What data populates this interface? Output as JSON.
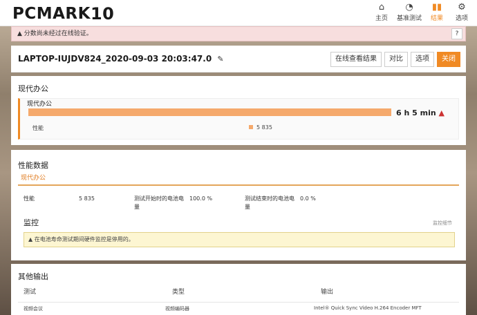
{
  "header": {
    "logo": "PCMARK",
    "logo_num": "10",
    "nav": [
      {
        "label": "主页",
        "icon": "home-icon"
      },
      {
        "label": "基准测试",
        "icon": "gauge-icon"
      },
      {
        "label": "结果",
        "icon": "bar-chart-icon"
      },
      {
        "label": "选项",
        "icon": "gear-icon"
      }
    ],
    "accent": "#f08a24"
  },
  "warning": {
    "text": "分数尚未经过在线验证。",
    "help": "?"
  },
  "result": {
    "title": "LAPTOP-IUJDV824_2020-09-03 20:03:47.0",
    "buttons": {
      "view_online": "在线查看结果",
      "compare": "对比",
      "options": "选项",
      "close": "关闭"
    }
  },
  "office": {
    "section": "现代办公",
    "inner_label": "现代办公",
    "time": "6 h 5 min",
    "perf_label": "性能",
    "perf_value": "5 835"
  },
  "perf": {
    "section": "性能数据",
    "tab": "现代办公",
    "rows": {
      "perf_label": "性能",
      "perf_value": "5 835",
      "start_label": "测试开始时的电池电量",
      "start_value": "100.0 %",
      "end_label": "测试结束时的电池电量",
      "end_value": "0.0 %"
    },
    "monitor_title": "监控",
    "monitor_link": "监控细节",
    "notice": "在电池寿命测试期间硬件监控是停用的。"
  },
  "other": {
    "section": "其他输出",
    "headers": [
      "测试",
      "类型",
      "输出"
    ],
    "row": [
      "视频会议",
      "视频编码器",
      "Intel® Quick Sync Video H.264 Encoder MFT"
    ]
  }
}
